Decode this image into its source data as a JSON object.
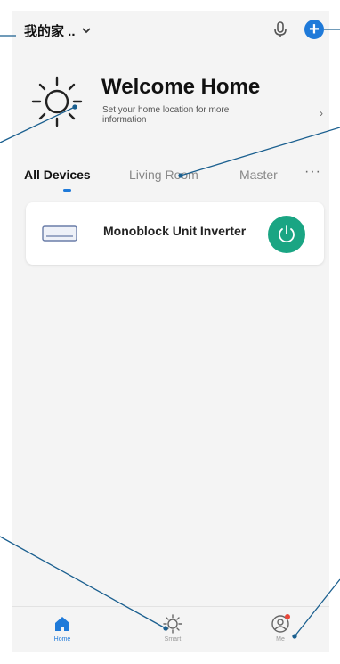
{
  "header": {
    "home_name": "我的家 ..",
    "dropdown_icon": "chevron-down-icon",
    "mic_icon": "microphone-icon",
    "add_icon": "plus-circle-icon",
    "add_glyph": "+"
  },
  "welcome": {
    "title": "Welcome Home",
    "subtitle": "Set your home location for more information",
    "arrow": "›",
    "icon": "sun-icon"
  },
  "tabs": [
    {
      "label": "All Devices",
      "active": true
    },
    {
      "label": "Living Room",
      "active": false
    },
    {
      "label": "Master",
      "active": false
    }
  ],
  "tabs_more": "···",
  "devices": [
    {
      "name": "Monoblock Unit Inverter",
      "icon": "air-conditioner-icon",
      "power_color": "#1aa583"
    }
  ],
  "tabbar": [
    {
      "label": "Home",
      "icon": "home-icon",
      "active": true
    },
    {
      "label": "Smart",
      "icon": "smart-sun-icon",
      "active": false
    },
    {
      "label": "Me",
      "icon": "user-icon",
      "active": false,
      "badge": true
    }
  ],
  "colors": {
    "accent": "#1f7ad9",
    "power": "#1aa583",
    "badge": "#e8473a",
    "callout": "#1a5f8f"
  }
}
